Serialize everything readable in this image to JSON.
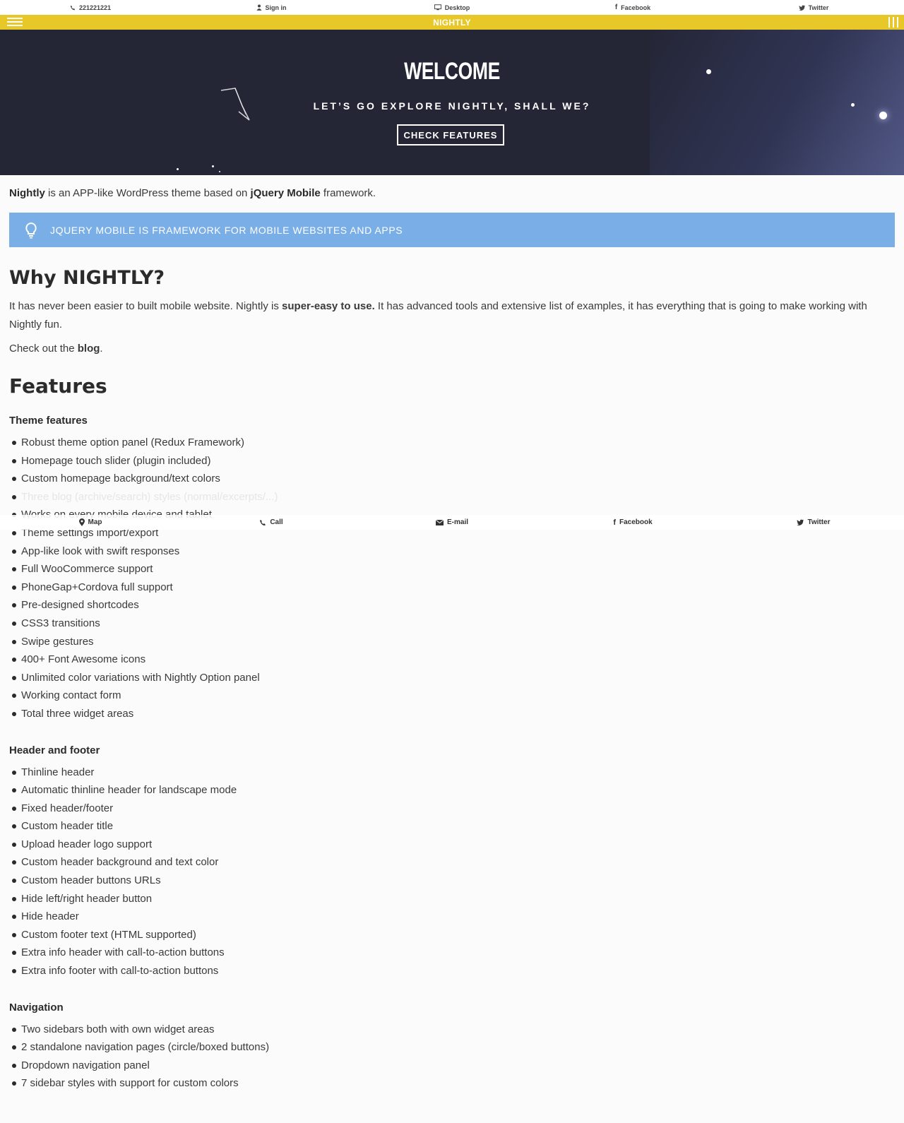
{
  "topbar": {
    "phone": "221221221",
    "signin": "Sign in",
    "desktop": "Desktop",
    "facebook": "Facebook",
    "twitter": "Twitter"
  },
  "header": {
    "title": "NIGHTLY"
  },
  "hero": {
    "title": "WELCOME",
    "subtitle": "LET’S GO EXPLORE NIGHTLY, SHALL WE?",
    "button": "CHECK FEATURES"
  },
  "intro": {
    "brand": "Nightly",
    "text1": " is an APP-like WordPress theme based on ",
    "framework": "jQuery Mobile",
    "text2": " framework."
  },
  "notice": {
    "text": "JQUERY MOBILE IS FRAMEWORK FOR MOBILE WEBSITES AND APPS"
  },
  "why": {
    "heading": "Why NIGHTLY?",
    "text1": "It has never been easier to built mobile website. Nightly is ",
    "bold": "super-easy to use.",
    "text2": " It has advanced tools and extensive list of examples, it has everything that is going to make working with Nightly fun.",
    "check_text": "Check out the ",
    "blog_link": "blog",
    "period": "."
  },
  "features": {
    "heading": "Features",
    "sections": [
      {
        "title": "Theme features",
        "items": [
          "Robust theme option panel (Redux Framework)",
          "Homepage touch slider (plugin included)",
          "Custom homepage background/text colors",
          "Three blog (archive/search) styles (normal/excerpts/...)",
          "Works on every mobile device and tablet",
          "Theme settings import/export",
          "App-like look with swift responses",
          "Full WooCommerce support",
          "PhoneGap+Cordova full support",
          "Pre-designed shortcodes",
          "CSS3 transitions",
          "Swipe gestures",
          "400+ Font Awesome icons",
          "Unlimited color variations with Nightly Option panel",
          "Working contact form",
          "Total three widget areas"
        ]
      },
      {
        "title": "Header and footer",
        "items": [
          "Thinline header",
          "Automatic thinline header for landscape mode",
          "Fixed header/footer",
          "Custom header title",
          "Upload header logo support",
          "Custom header background and text color",
          "Custom header buttons URLs",
          "Hide left/right header button",
          "Hide header",
          "Custom footer text (HTML supported)",
          "Extra info header with call-to-action buttons",
          "Extra info footer with call-to-action buttons"
        ]
      },
      {
        "title": "Navigation",
        "items": [
          "Two sidebars both with own widget areas",
          "2 standalone navigation pages (circle/boxed buttons)",
          "Dropdown navigation panel",
          "7 sidebar styles with support for custom colors"
        ]
      }
    ]
  },
  "footerbar": {
    "map": "Map",
    "call": "Call",
    "email": "E-mail",
    "facebook": "Facebook",
    "twitter": "Twitter"
  },
  "colors": {
    "header_yellow": "#e8c828",
    "hero_bg": "#242636",
    "notice_blue": "#7aaee6"
  }
}
